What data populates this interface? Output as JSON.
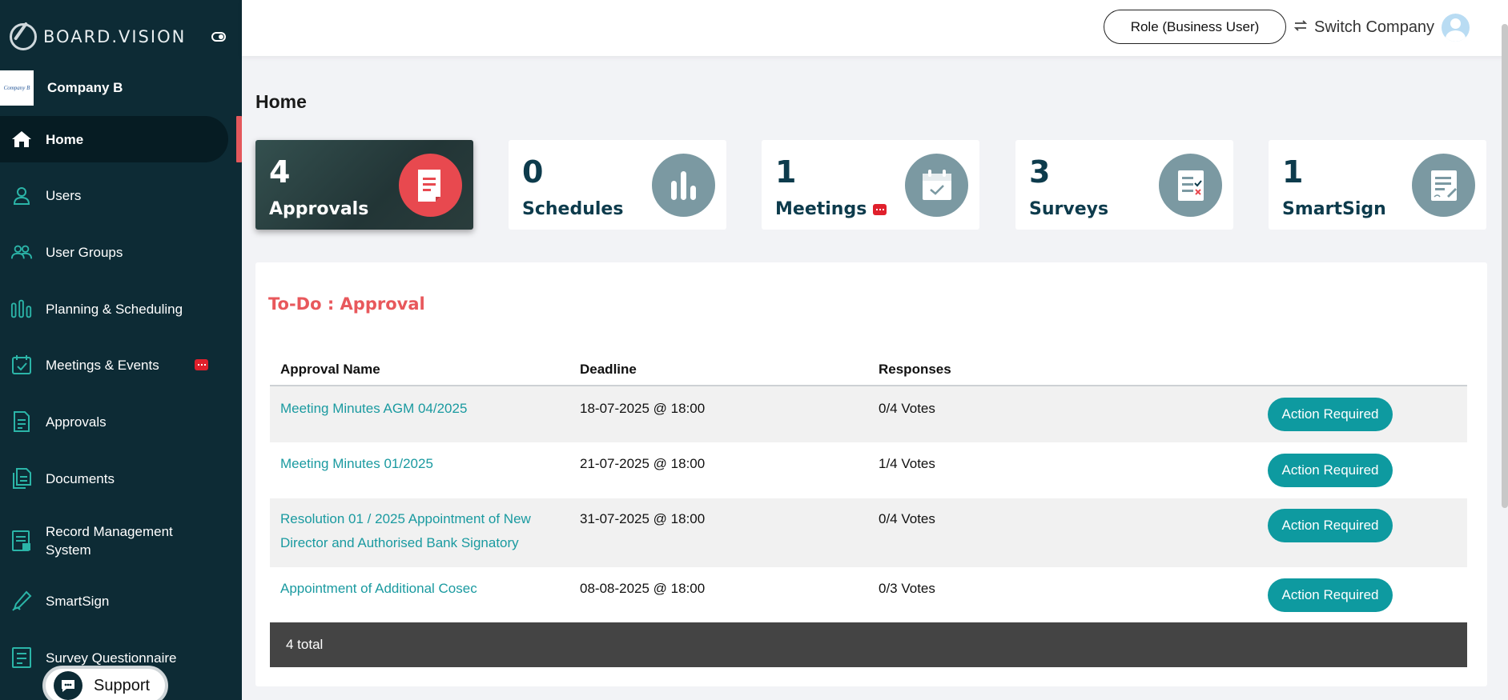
{
  "brand": {
    "name": "BOARD.VISION"
  },
  "company": {
    "logo_text": "Company B",
    "name": "Company B"
  },
  "sidebar": {
    "items": [
      {
        "label": "Home",
        "icon": "home-icon"
      },
      {
        "label": "Users",
        "icon": "user-icon"
      },
      {
        "label": "User Groups",
        "icon": "user-groups-icon"
      },
      {
        "label": "Planning & Scheduling",
        "icon": "planning-icon"
      },
      {
        "label": "Meetings & Events",
        "icon": "calendar-icon"
      },
      {
        "label": "Approvals",
        "icon": "document-icon"
      },
      {
        "label": "Documents",
        "icon": "documents-icon"
      },
      {
        "label": "Record Management System",
        "icon": "record-icon"
      },
      {
        "label": "SmartSign",
        "icon": "pen-icon"
      },
      {
        "label": "Survey Questionnaire",
        "icon": "survey-icon"
      }
    ]
  },
  "support": {
    "label": "Support"
  },
  "header": {
    "role_label": "Role (Business User)",
    "switch_label": "Switch Company"
  },
  "page": {
    "title": "Home"
  },
  "stats": [
    {
      "count": "4",
      "label": "Approvals"
    },
    {
      "count": "0",
      "label": "Schedules"
    },
    {
      "count": "1",
      "label": "Meetings"
    },
    {
      "count": "3",
      "label": "Surveys"
    },
    {
      "count": "1",
      "label": "SmartSign"
    }
  ],
  "todo": {
    "title": "To-Do : Approval",
    "columns": [
      "Approval Name",
      "Deadline",
      "Responses"
    ],
    "rows": [
      {
        "name": "Meeting Minutes AGM 04/2025",
        "deadline": "18-07-2025 @ 18:00",
        "responses": "0/4 Votes",
        "action": "Action Required"
      },
      {
        "name": "Meeting Minutes 01/2025",
        "deadline": "21-07-2025 @ 18:00",
        "responses": "1/4 Votes",
        "action": "Action Required"
      },
      {
        "name": "Resolution 01 / 2025 Appointment of New Director and Authorised Bank Signatory",
        "deadline": "31-07-2025 @ 18:00",
        "responses": "0/4 Votes",
        "action": "Action Required"
      },
      {
        "name": "Appointment of Additional Cosec",
        "deadline": "08-08-2025 @ 18:00",
        "responses": "0/3 Votes",
        "action": "Action Required"
      }
    ],
    "footer": "4 total"
  },
  "colors": {
    "sidebar": "#0d2b35",
    "accent": "#e8585c",
    "teal": "#0e9aa0",
    "link": "#1a9aa0"
  }
}
